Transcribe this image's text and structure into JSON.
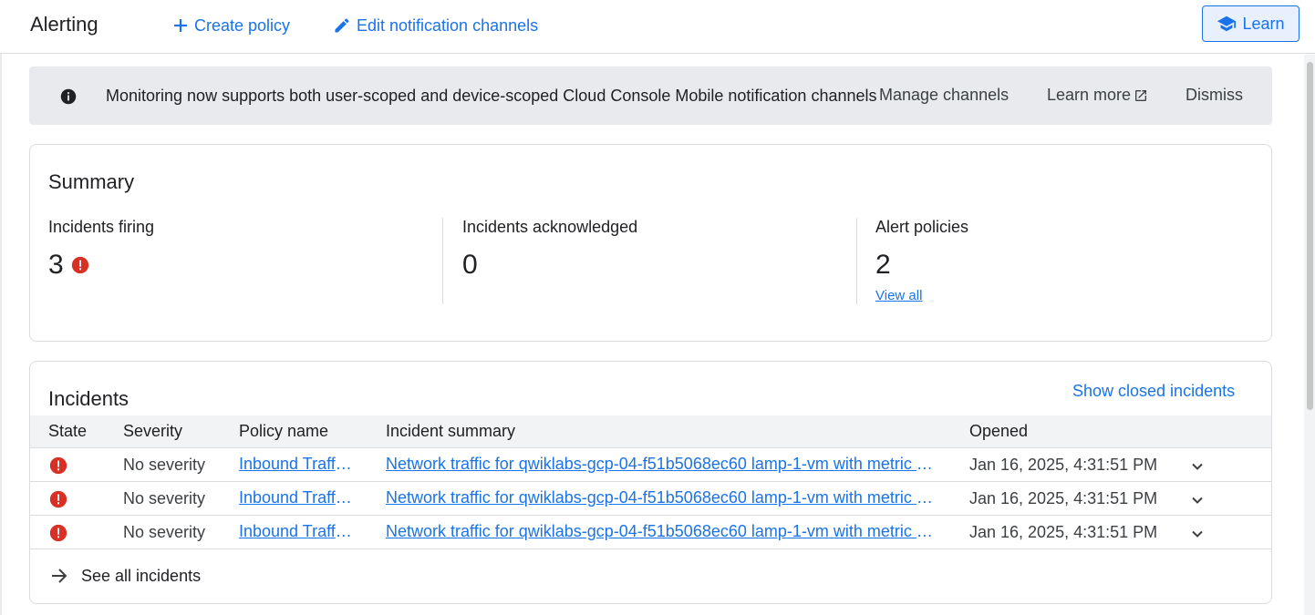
{
  "header": {
    "title": "Alerting",
    "create_policy": "Create policy",
    "edit_channels": "Edit notification channels",
    "learn": "Learn"
  },
  "banner": {
    "message": "Monitoring now supports both user-scoped and device-scoped Cloud Console Mobile notification channels",
    "manage_channels": "Manage channels",
    "learn_more": "Learn more",
    "dismiss": "Dismiss"
  },
  "summary": {
    "title": "Summary",
    "incidents_firing": {
      "label": "Incidents firing",
      "value": "3"
    },
    "incidents_acknowledged": {
      "label": "Incidents acknowledged",
      "value": "0"
    },
    "alert_policies": {
      "label": "Alert policies",
      "value": "2",
      "link": "View all"
    }
  },
  "incidents": {
    "title": "Incidents",
    "show_closed": "Show closed incidents",
    "columns": {
      "state": "State",
      "severity": "Severity",
      "policy": "Policy name",
      "summary": "Incident summary",
      "opened": "Opened"
    },
    "rows": [
      {
        "severity": "No severity",
        "policy": "Inbound Traffi…",
        "summary": "Network traffic for qwiklabs-gcp-04-f51b5068ec60 lamp-1-vm with metric la…",
        "opened": "Jan 16, 2025, 4:31:51 PM"
      },
      {
        "severity": "No severity",
        "policy": "Inbound Traffi…",
        "summary": "Network traffic for qwiklabs-gcp-04-f51b5068ec60 lamp-1-vm with metric la…",
        "opened": "Jan 16, 2025, 4:31:51 PM"
      },
      {
        "severity": "No severity",
        "policy": "Inbound Traffi…",
        "summary": "Network traffic for qwiklabs-gcp-04-f51b5068ec60 lamp-1-vm with metric la…",
        "opened": "Jan 16, 2025, 4:31:51 PM"
      }
    ],
    "see_all": "See all incidents"
  },
  "colors": {
    "accent": "#1a73e8",
    "error": "#d93025",
    "banner_bg": "#e8eaed"
  }
}
